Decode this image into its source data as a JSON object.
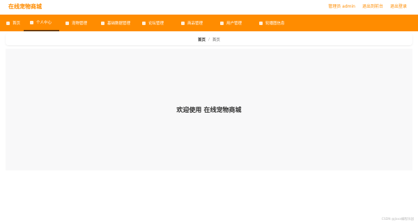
{
  "app": {
    "title": "在线宠物商城"
  },
  "header": {
    "admin_label": "管理员 admin",
    "switch_role": "退出到前台",
    "logout": "退出登录"
  },
  "nav": {
    "items": [
      {
        "label": "首页",
        "active": false
      },
      {
        "label": "个人中心",
        "active": true
      },
      {
        "label": "宠物管理",
        "active": false
      },
      {
        "label": "基础数据管理",
        "active": false
      },
      {
        "label": "论坛管理",
        "active": false
      },
      {
        "label": "商品管理",
        "active": false
      },
      {
        "label": "用户管理",
        "active": false
      },
      {
        "label": "轮播图信息",
        "active": false
      }
    ]
  },
  "breadcrumb": {
    "home": "首页",
    "separator": "/",
    "current": "首页"
  },
  "main": {
    "welcome": "欢迎使用 在线宠物商城"
  },
  "footer": {
    "watermark": "CSDN @Java编程乐园"
  },
  "colors": {
    "accent": "#ff8c00",
    "nav_text": "#ffffff",
    "content_bg": "#f8f8f9"
  }
}
